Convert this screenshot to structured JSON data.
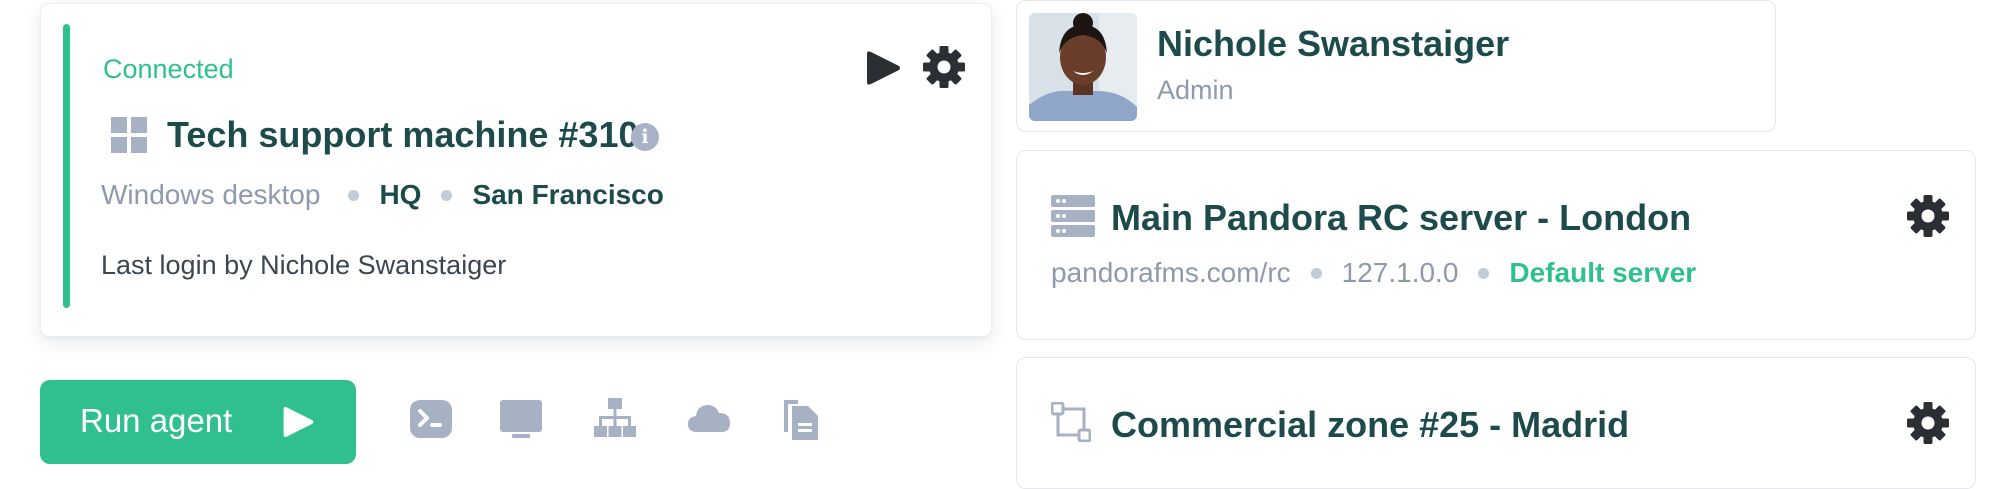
{
  "machine": {
    "status": "Connected",
    "title": "Tech support machine #310",
    "type": "Windows desktop",
    "group": "HQ",
    "location": "San Francisco",
    "last_login": "Last login by Nichole Swanstaiger",
    "icons": [
      "windows-icon",
      "info-icon",
      "play-icon",
      "gear-icon"
    ]
  },
  "actions": {
    "run_agent_label": "Run agent",
    "tools": [
      "terminal-icon",
      "monitor-icon",
      "network-icon",
      "cloud-icon",
      "files-icon"
    ]
  },
  "user": {
    "name": "Nichole Swanstaiger",
    "role": "Admin"
  },
  "server": {
    "title": "Main Pandora RC server - London",
    "url": "pandorafms.com/rc",
    "ip": "127.1.0.0",
    "badge": "Default server"
  },
  "zone": {
    "title": "Commercial zone #25 - Madrid"
  },
  "colors": {
    "accent": "#30c08f",
    "text_dark": "#1d4a4a",
    "text_muted": "#8e9aab",
    "icon_gray": "#a6b1c4"
  }
}
